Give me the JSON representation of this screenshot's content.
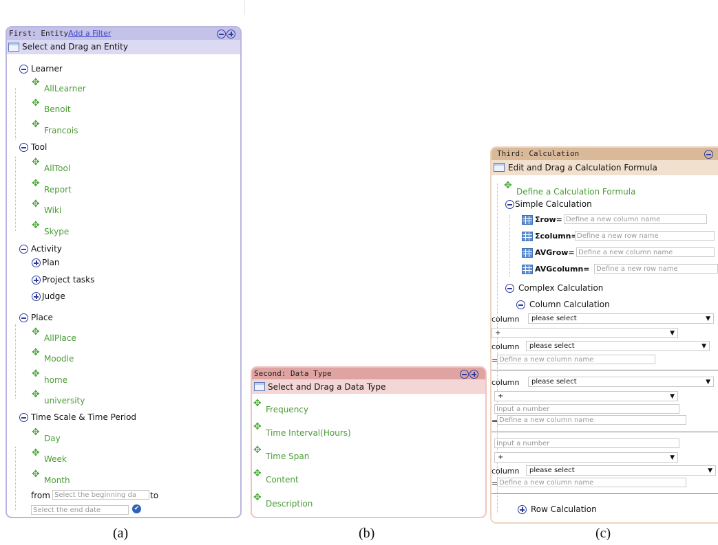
{
  "panel_a": {
    "header_title": "First: Entity",
    "add_filter": "Add a Filter",
    "subheader": "Select and Drag an Entity",
    "groups": {
      "learner": {
        "label": "Learner",
        "items": [
          "AllLearner",
          "Benoit",
          "Francois"
        ]
      },
      "tool": {
        "label": "Tool",
        "items": [
          "AllTool",
          "Report",
          "Wiki",
          "Skype"
        ]
      },
      "activity": {
        "label": "Activity",
        "items": [
          "Plan",
          "Project tasks",
          "Judge"
        ]
      },
      "place": {
        "label": "Place",
        "items": [
          "AllPlace",
          "Moodle",
          "home",
          "university"
        ]
      },
      "time": {
        "label": "Time Scale & Time Period",
        "items": [
          "Day",
          "Week",
          "Month"
        ]
      }
    },
    "from_label": "from",
    "to_label": "to",
    "begin_placeholder": "Select the beginning da",
    "end_placeholder": "Select the end date"
  },
  "panel_b": {
    "header_title": "Second: Data Type",
    "subheader": "Select and Drag a Data Type",
    "items": [
      "Frequency",
      "Time Interval(Hours)",
      "Time Span",
      "Content",
      "Description"
    ]
  },
  "panel_c": {
    "header_title": "Third: Calculation",
    "subheader": "Edit and Drag a Calculation Formula",
    "define_formula": "Define a Calculation Formula",
    "simple_label": "Simple Calculation",
    "simple_rows": [
      {
        "label": "Σrow=",
        "placeholder": "Define a new column name"
      },
      {
        "label": "Σcolumn=",
        "placeholder": "Define a new row name"
      },
      {
        "label": "AVGrow=",
        "placeholder": "Define a new column name"
      },
      {
        "label": "AVGcolumn=",
        "placeholder": "Define a new row name"
      }
    ],
    "complex_label": "Complex Calculation",
    "column_calc_label": "Column Calculation",
    "row_calc_label": "Row Calculation",
    "column_word": "column",
    "please_select": "please select",
    "plus_op": "+",
    "equals": "=",
    "new_column_placeholder": "Define a new column name",
    "number_placeholder": "Input a number"
  },
  "captions": [
    "(a)",
    "(b)",
    "(c)"
  ]
}
